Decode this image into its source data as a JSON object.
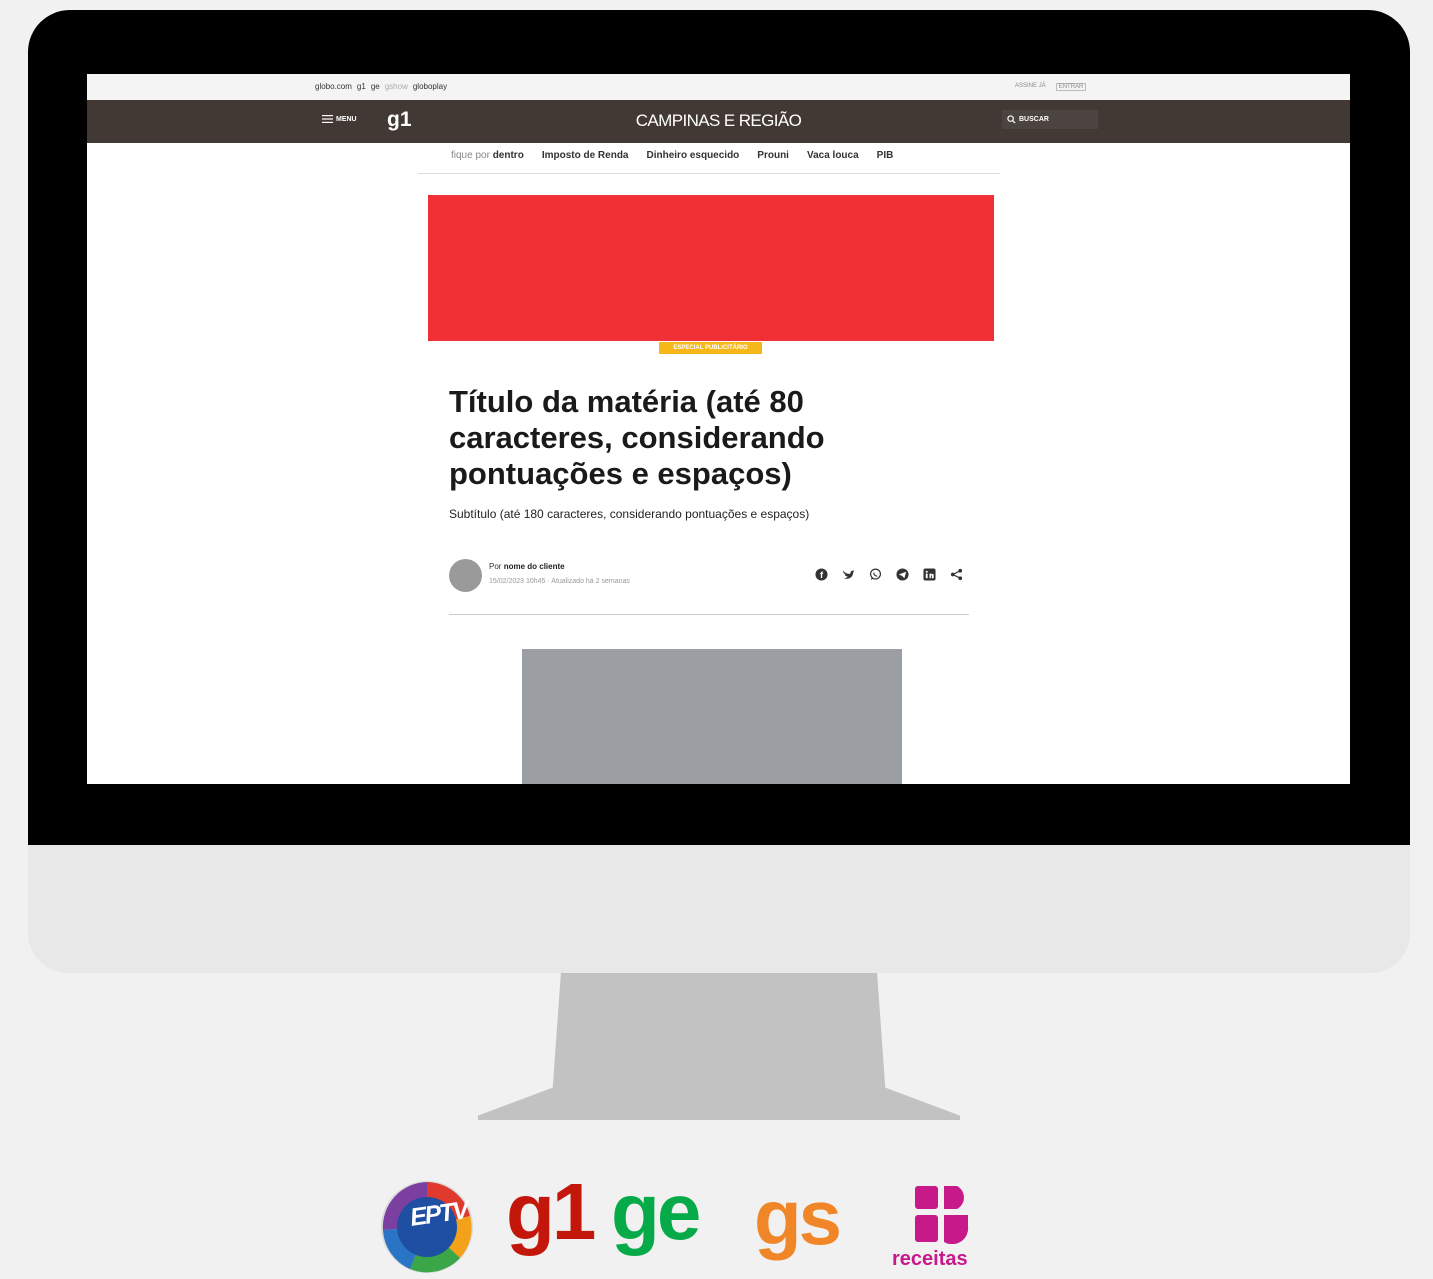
{
  "topbar": {
    "items": [
      "globo.com",
      "g1",
      "ge",
      "gshow",
      "globoplay"
    ],
    "assine": "ASSINE JÁ",
    "entrar": "ENTRAR"
  },
  "header": {
    "menu_label": "MENU",
    "logo": "g1",
    "region": "CAMPINAS E REGIÃO",
    "search_label": "BUSCAR"
  },
  "nav": {
    "prefix": "fique por",
    "items": [
      "dentro",
      "Imposto de Renda",
      "Dinheiro esquecido",
      "Prouni",
      "Vaca louca",
      "PIB"
    ]
  },
  "article": {
    "tag": "ESPECIAL PUBLICITÁRIO",
    "title": "Título da matéria (até 80 caracteres, considerando pontuações e espaços)",
    "subtitle": "Subtítulo (até 180 caracteres, considerando pontuações e espaços)",
    "byline_prefix": "Por",
    "author": "nome do cliente",
    "date": "15/02/2023 10h45 · Atualizado há 2 semanas"
  },
  "share_icons": [
    "facebook-icon",
    "twitter-icon",
    "whatsapp-icon",
    "telegram-icon",
    "linkedin-icon",
    "share-icon"
  ],
  "brands": {
    "eptv": "EPTV",
    "g1": "g1",
    "ge": "ge",
    "gs": "gs",
    "receitas": "receitas"
  },
  "colors": {
    "header_bg": "#423934",
    "ad_red": "#f03034",
    "tag_yellow": "#f5b818",
    "g1_red": "#c4170c",
    "ge_green": "#06aa48",
    "gs_orange": "#f08627",
    "receitas_pink": "#c8198a"
  }
}
